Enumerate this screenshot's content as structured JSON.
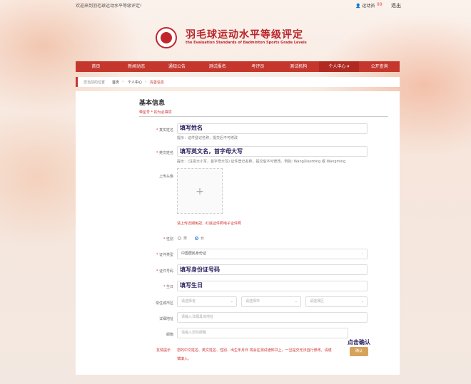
{
  "topbar": {
    "welcome": "欢迎来到羽毛球运动水平等级评定!",
    "user": "运动员",
    "badge": "99",
    "logout": "退出"
  },
  "header": {
    "title_cn": "羽毛球运动水平等级评定",
    "title_en": "the Evaluation Standards of Badminton Sports Grade Levels"
  },
  "nav": {
    "items": [
      "首页",
      "新闻动态",
      "通知公告",
      "测试报名",
      "考评员",
      "测试机构",
      "个人中心",
      "公开查询"
    ]
  },
  "breadcrumb": {
    "prefix": "您当前的位置",
    "home": "首页",
    "sep1": "›",
    "mid": "个人中心",
    "sep2": "›",
    "current": "完善信息"
  },
  "form": {
    "section_title": "基本信息",
    "required_note": "带星号 * 的为必填项",
    "name": {
      "label": "真实姓名",
      "annotation": "填写姓名",
      "hint": "提示：证件登记名称，提交后不可修改"
    },
    "en_name": {
      "label": "英文姓名",
      "annotation": "填写英文名，首字母大写",
      "hint": "提示：(注意大小写，首字母大写) 证件登记名称，提交后不可修改。例如: WangXiaoming 或 Wangming"
    },
    "avatar": {
      "label": "上传头像",
      "plus": "+",
      "warning": "请上传近期免冠、红底证件照电子证件照"
    },
    "gender": {
      "label": "性别",
      "male": "男",
      "female": "女"
    },
    "id_type": {
      "label": "证件类型",
      "value": "中国居民身份证"
    },
    "id_number": {
      "label": "证件号码",
      "annotation": "填写身份证号码"
    },
    "birthday": {
      "label": "生日",
      "annotation": "填写生日"
    },
    "city": {
      "label": "常住城市区",
      "province": "请选择省",
      "city": "请选择市",
      "district": "请选择区"
    },
    "address": {
      "label": "详细地址",
      "placeholder": "请输入详细具体地址"
    },
    "email": {
      "label": "邮箱",
      "placeholder": "请输入您的邮箱"
    },
    "notice": {
      "label": "友情提示",
      "text1": "您的中文姓名、英文姓名、性别、出生年月日 将会在测试通知书上，一旦提交无法自行修改，请谨",
      "text2": "慎填入。"
    },
    "confirm": {
      "annotation": "点击确认",
      "button": "确认"
    }
  }
}
